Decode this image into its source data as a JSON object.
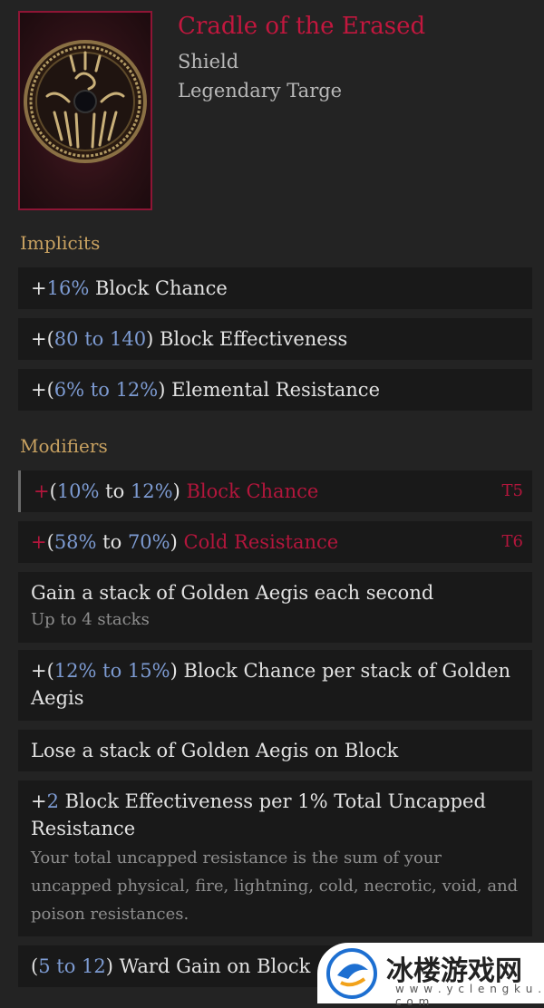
{
  "item": {
    "name": "Cradle of the Erased",
    "type": "Shield",
    "base": "Legendary Targe",
    "icon": "sun-shield-icon"
  },
  "implicits": {
    "title": "Implicits",
    "rows": [
      {
        "prefix": "+",
        "num": "16%",
        "text": " Block Chance"
      },
      {
        "prefix": "+(",
        "num1": "80",
        "mid": " to ",
        "num2": "140",
        "suffix": ")",
        "text": " Block Effectiveness"
      },
      {
        "prefix": "+(",
        "num1": "6%",
        "mid": " to ",
        "num2": "12%",
        "suffix": ")",
        "text": " Elemental Resistance"
      }
    ]
  },
  "modifiers": {
    "title": "Modifiers",
    "rows": [
      {
        "prefix": "+",
        "open": "(",
        "num1": "10%",
        "mid": " to ",
        "num2": "12%",
        "close": ")",
        "text": " Block Chance",
        "tier": "T5"
      },
      {
        "prefix": "+",
        "open": "(",
        "num1": "58%",
        "mid": " to ",
        "num2": "70%",
        "close": ")",
        "text": " Cold Resistance",
        "tier": "T6"
      },
      {
        "text": "Gain a stack of Golden Aegis each second",
        "sub": "Up to 4 stacks"
      },
      {
        "prefix": "+(",
        "num1": "12%",
        "mid": " to ",
        "num2": "15%",
        "suffix": ")",
        "text": " Block Chance per stack of Golden Aegis"
      },
      {
        "text": "Lose a stack of Golden Aegis on Block"
      },
      {
        "prefix": "+",
        "num": "2",
        "text": " Block Effectiveness per 1% Total Uncapped Resistance",
        "sub": "Your total uncapped resistance is the sum of your uncapped physical, fire, lightning, cold, necrotic, void, and poison resistances."
      },
      {
        "prefix": "(",
        "num1": "5",
        "mid": " to ",
        "num2": "12",
        "suffix": ")",
        "text": " Ward Gain on Block"
      }
    ]
  },
  "watermark": {
    "text": "冰楼游戏网",
    "url": "w w w . y c l e n g k u . c o m"
  },
  "colors": {
    "item_name": "#c2173e",
    "section": "#c9a261",
    "number": "#7d9bd2",
    "negative": "#b3163c",
    "background": "#232323",
    "row_bg": "#191919"
  }
}
